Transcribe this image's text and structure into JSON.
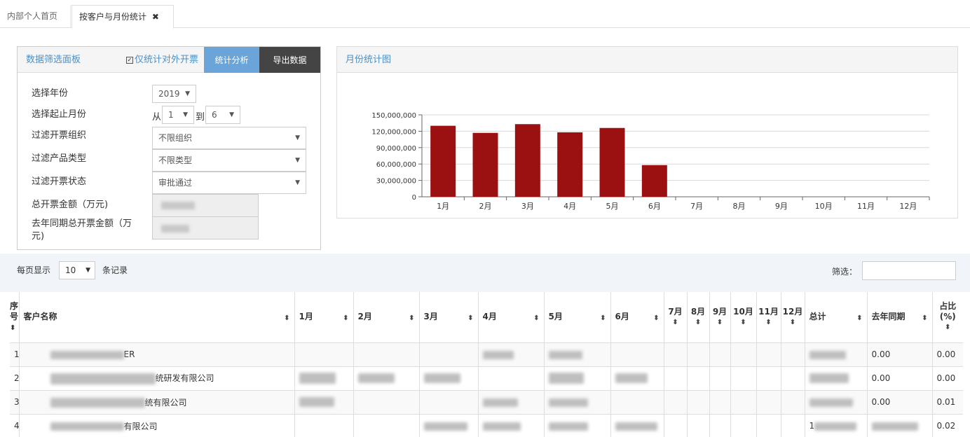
{
  "tabs": [
    {
      "label": "内部个人首页"
    },
    {
      "label": "按客户与月份统计",
      "close": "✖"
    }
  ],
  "filter_panel": {
    "title": "数据筛选面板",
    "checkbox_label": "仅统计对外开票",
    "checkbox_checked": true,
    "analyze_button": "统计分析",
    "export_button": "导出数据",
    "year_label": "选择年份",
    "year_value": "2019",
    "month_range_label": "选择起止月份",
    "from_text": "从",
    "to_text": "到",
    "from_month": "1",
    "to_month": "6",
    "org_label": "过滤开票组织",
    "org_value": "不限组织",
    "product_label": "过滤产品类型",
    "product_value": "不限类型",
    "status_label": "过滤开票状态",
    "status_value": "审批通过",
    "total_label": "总开票金额（万元)",
    "lastyear_label": "去年同期总开票金额（万元)"
  },
  "chart_panel": {
    "title": "月份统计图"
  },
  "chart_data": {
    "type": "bar",
    "categories": [
      "1月",
      "2月",
      "3月",
      "4月",
      "5月",
      "6月",
      "7月",
      "8月",
      "9月",
      "10月",
      "11月",
      "12月"
    ],
    "values": [
      130000000,
      117000000,
      133000000,
      118000000,
      126000000,
      58000000,
      0,
      0,
      0,
      0,
      0,
      0
    ],
    "ylim": [
      0,
      150000000
    ],
    "yticks": [
      "0",
      "30,000,000",
      "60,000,000",
      "90,000,000",
      "120,000,000",
      "150,000,000"
    ],
    "bar_color": "#9b1111",
    "grid": true
  },
  "table_controls": {
    "show_label": "每页显示",
    "page_length": "10",
    "records_label": "条记录",
    "filter_label": "筛选："
  },
  "table": {
    "headers": [
      "序号",
      "客户名称",
      "1月",
      "2月",
      "3月",
      "4月",
      "5月",
      "6月",
      "7月",
      "8月",
      "9月",
      "10月",
      "11月",
      "12月",
      "总计",
      "去年同期",
      "占比(%)"
    ],
    "rows": [
      {
        "no": "1",
        "name": "ER",
        "lastyear": "0.00",
        "pct": "0.00"
      },
      {
        "no": "2",
        "name": "统研发有限公司",
        "lastyear": "0.00",
        "pct": "0.00"
      },
      {
        "no": "3",
        "name": "统有限公司",
        "lastyear": "0.00",
        "pct": "0.01"
      },
      {
        "no": "4",
        "name": "有限公司",
        "total_prefix": "1",
        "lastyear": "",
        "pct": "0.02"
      }
    ]
  }
}
